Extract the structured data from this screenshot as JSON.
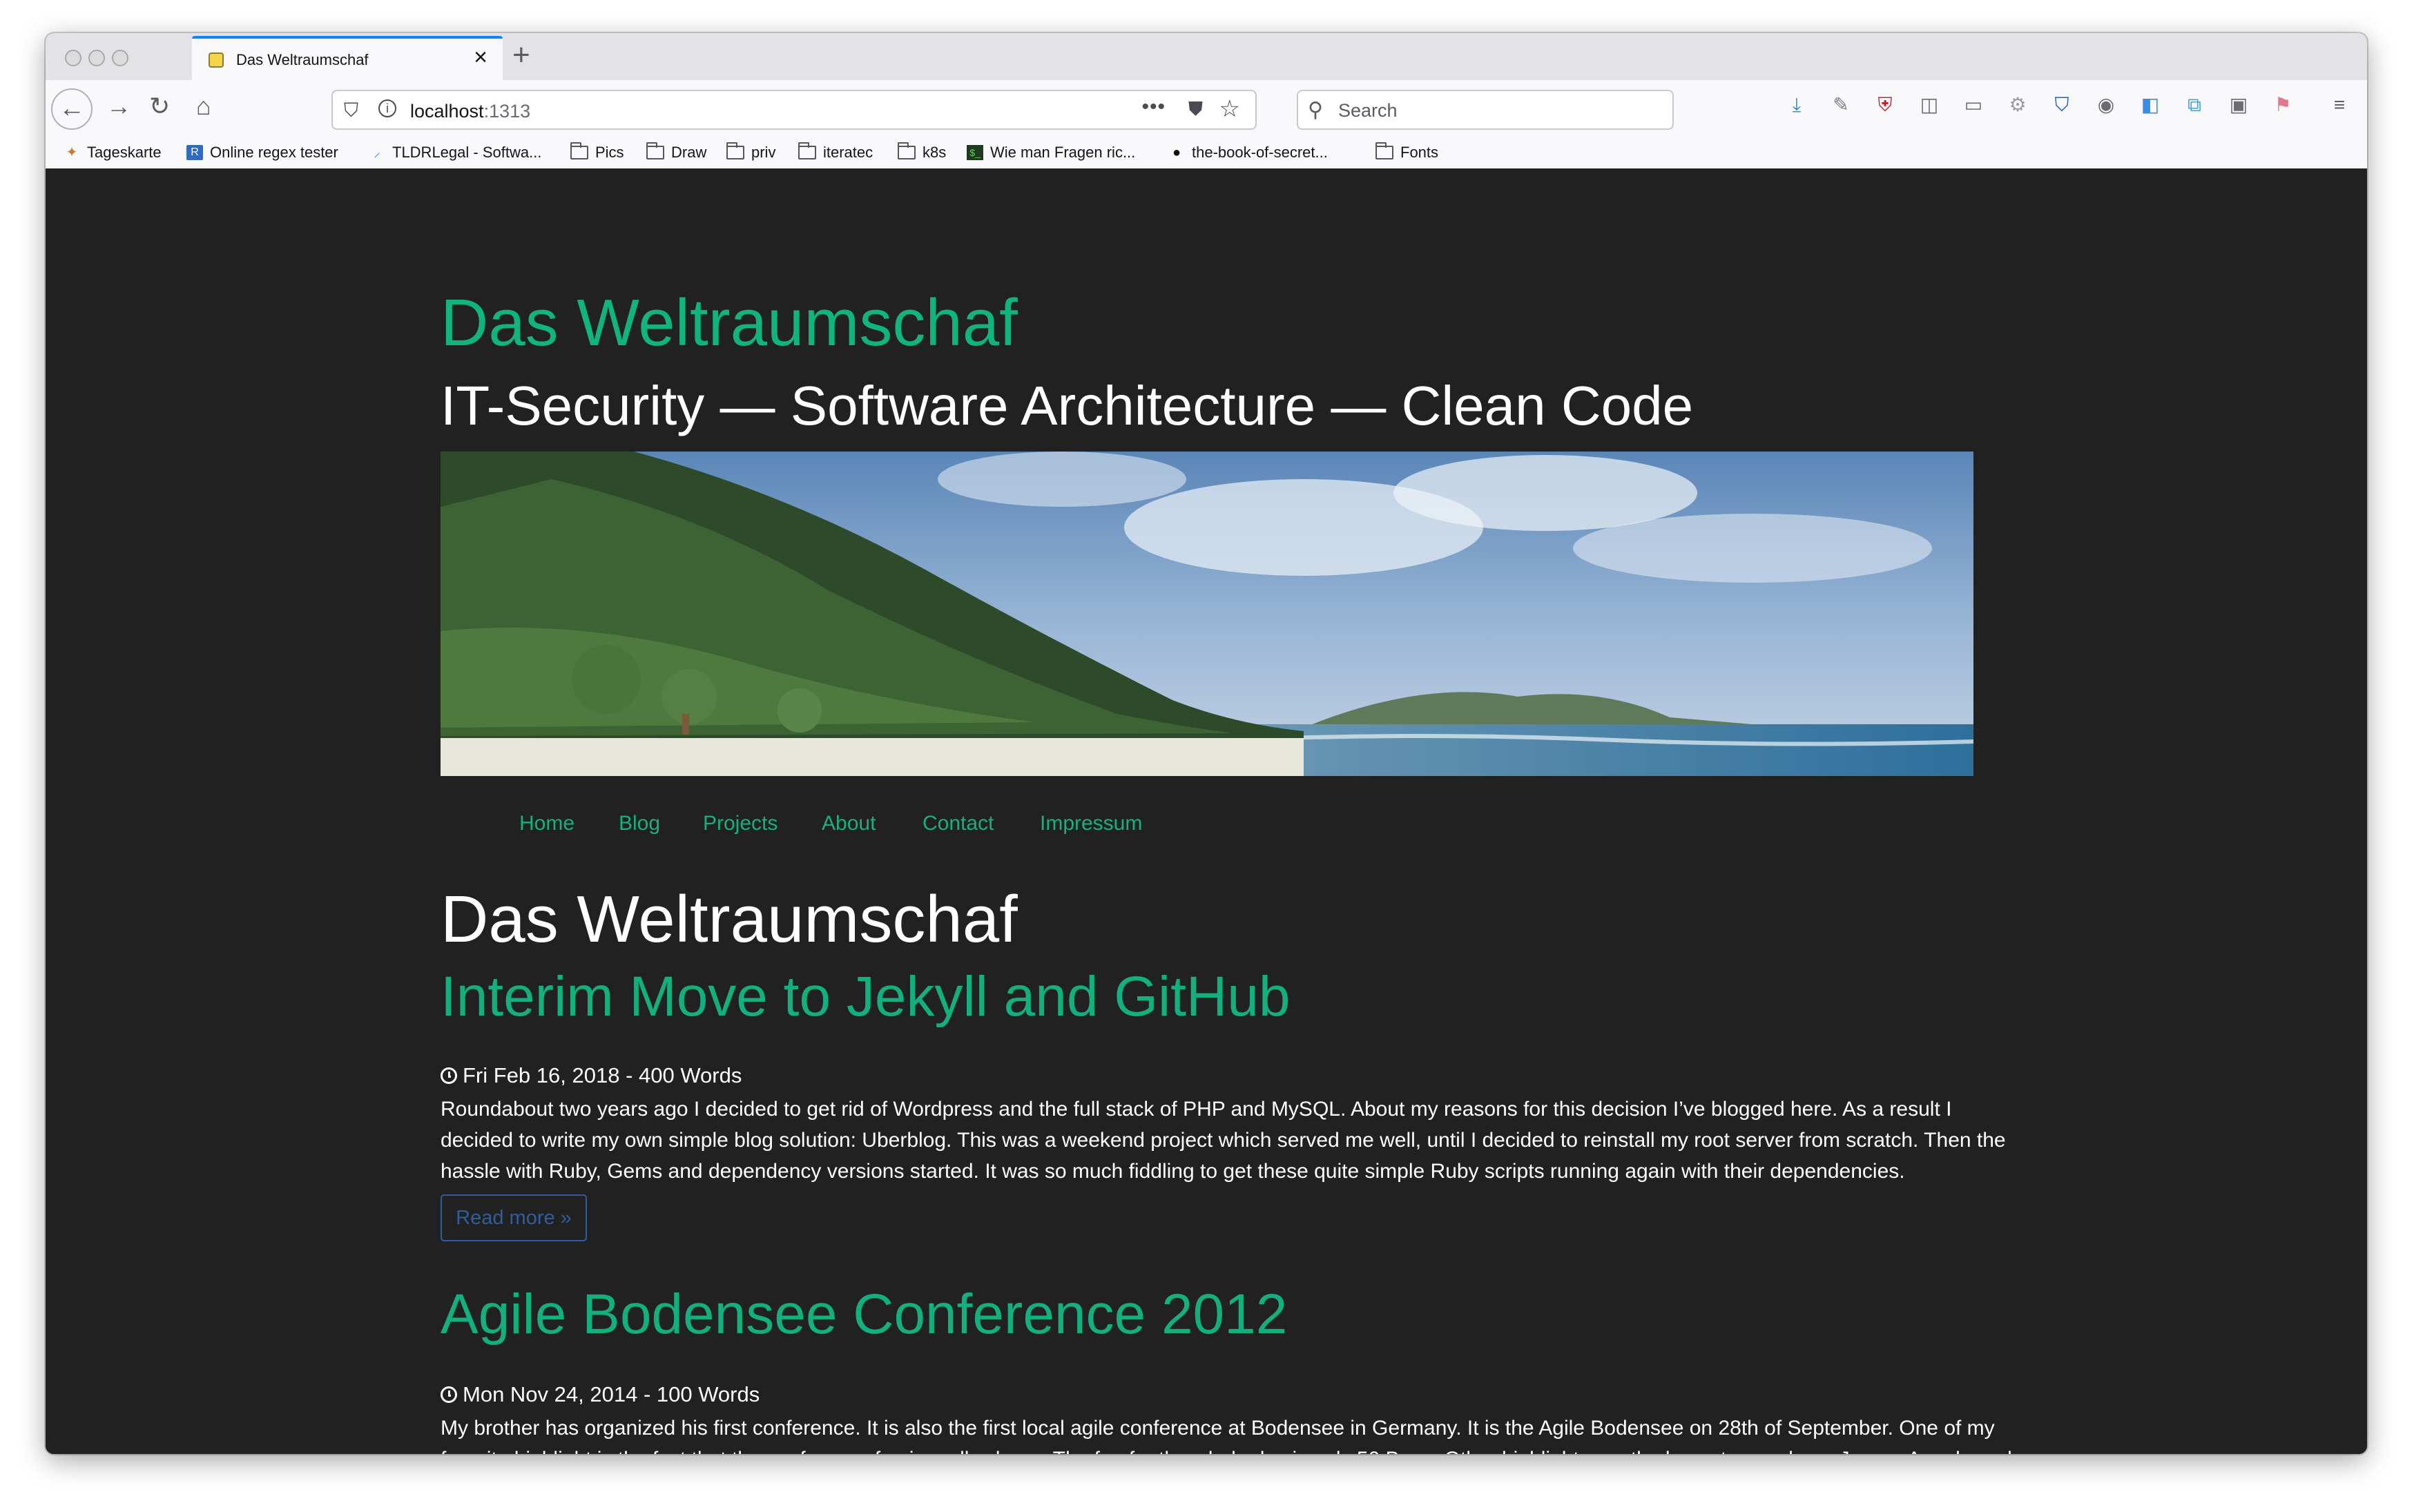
{
  "browser": {
    "tab_title": "Das Weltraumschaf",
    "url_host": "localhost",
    "url_port": ":1313",
    "search_placeholder": "Search",
    "bookmarks": [
      {
        "label": "Tageskarte",
        "icon": "tageskarte-icon"
      },
      {
        "label": "Online regex tester",
        "icon": "regex-icon"
      },
      {
        "label": "TLDRLegal - Softwa...",
        "icon": "tldrlegal-icon"
      },
      {
        "label": "Pics",
        "icon": "folder-icon"
      },
      {
        "label": "Draw",
        "icon": "folder-icon"
      },
      {
        "label": "priv",
        "icon": "folder-icon"
      },
      {
        "label": "iteratec",
        "icon": "folder-icon"
      },
      {
        "label": "k8s",
        "icon": "folder-icon"
      },
      {
        "label": "Wie man Fragen ric...",
        "icon": "terminal-icon"
      },
      {
        "label": "the-book-of-secret...",
        "icon": "github-icon"
      },
      {
        "label": "Fonts",
        "icon": "folder-icon"
      }
    ]
  },
  "site": {
    "title": "Das Weltraumschaf",
    "tagline": "IT-Security — Software Architecture — Clean Code",
    "nav": [
      "Home",
      "Blog",
      "Projects",
      "About",
      "Contact",
      "Impressum"
    ]
  },
  "page": {
    "heading": "Das Weltraumschaf",
    "read_more": "Read more »",
    "posts": [
      {
        "title": "Interim Move to Jekyll and GitHub",
        "meta": "Fri Feb 16, 2018 - 400 Words",
        "excerpt": "Roundabout two years ago I decided to get rid of Wordpress and the full stack of PHP and MySQL. About my reasons for this decision I’ve blogged here. As a result I decided to write my own simple blog solution: Uberblog. This was a weekend project which served me well, until I decided to reinstall my root server from scratch. Then the hassle with Ruby, Gems and dependency versions started. It was so much fiddling to get these quite simple Ruby scripts running again with their dependencies."
      },
      {
        "title": "Agile Bodensee Conference 2012",
        "meta": "Mon Nov 24, 2014 - 100 Words",
        "excerpt": "My brother has organized his first conference. It is also the first local agile conference at Bodensee in Germany. It is the Agile Bodensee on 28th of September. One of my favorite highlight is the fact that the conference fee is really cheap. The fee for the whole day is only 50 Bugs. Other highlights are the keynote speakers: Jurgen Appelo and"
      }
    ]
  },
  "colors": {
    "accent": "#12b07f",
    "background": "#212121",
    "read_more_border": "#2f5e9e"
  }
}
